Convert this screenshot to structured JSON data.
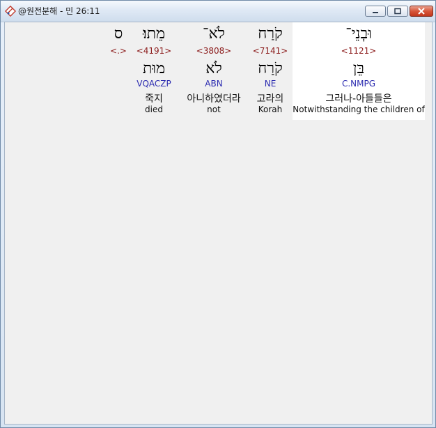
{
  "window": {
    "title": "@원전분해 - 민 26:11"
  },
  "words": [
    {
      "hebrew": "וּבְנֵי־",
      "strong": "<1121>",
      "lexeme": "בֵּן",
      "morph": "C.NMPG",
      "korean": "그러나-아들들은",
      "english": "Notwithstanding the children of",
      "highlighted": true
    },
    {
      "hebrew": "קֹרַח",
      "strong": "<7141>",
      "lexeme": "קֹרַח",
      "morph": "NE",
      "korean": "고라의",
      "english": "Korah",
      "highlighted": false
    },
    {
      "hebrew": "לֹא־",
      "strong": "<3808>",
      "lexeme": "לֹא",
      "morph": "ABN",
      "korean": "아니하였더라",
      "english": "not",
      "highlighted": false
    },
    {
      "hebrew": "מֵתוּ׃",
      "strong": "<4191>",
      "lexeme": "מוּת",
      "morph": "VQACZP",
      "korean": "죽지",
      "english": "died",
      "highlighted": false
    },
    {
      "hebrew": "ס",
      "strong": "<.>",
      "lexeme": "",
      "morph": "",
      "korean": "",
      "english": "",
      "highlighted": false
    }
  ],
  "colors": {
    "strong": "#8b1a1a",
    "morph": "#2b2bb0",
    "highlight": "#ffffff"
  }
}
